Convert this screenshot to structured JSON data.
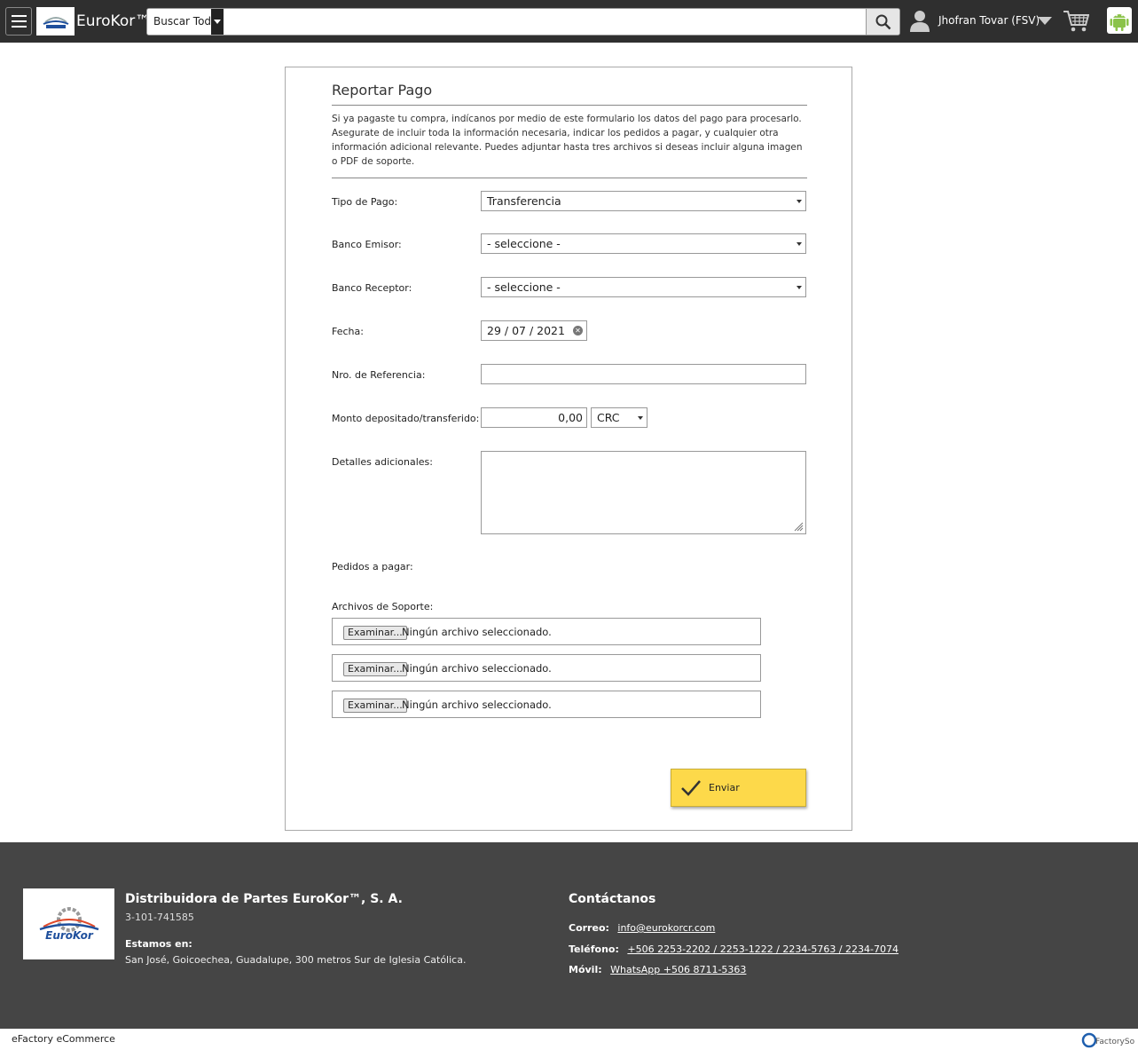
{
  "header": {
    "brand": "EuroKor™",
    "search_category": "Buscar Todo",
    "search_placeholder": "",
    "user_name": "Jhofran Tovar (FSV)"
  },
  "form": {
    "title": "Reportar Pago",
    "intro": "Si ya pagaste tu compra, indícanos por medio de este formulario los datos del pago para procesarlo. Asegurate de incluir toda la información necesaria, indicar los pedidos a pagar, y cualquier otra información adicional relevante. Puedes adjuntar hasta tres archivos si deseas incluir alguna imagen o PDF de soporte.",
    "fields": {
      "tipo_pago": {
        "label": "Tipo de Pago:",
        "value": "Transferencia"
      },
      "banco_emisor": {
        "label": "Banco Emisor:",
        "value": "- seleccione -"
      },
      "banco_receptor": {
        "label": "Banco Receptor:",
        "value": "- seleccione -"
      },
      "fecha": {
        "label": "Fecha:",
        "value": "29 / 07 / 2021"
      },
      "referencia": {
        "label": "Nro. de Referencia:",
        "value": ""
      },
      "monto": {
        "label": "Monto depositado/transferido:",
        "value": "0,00",
        "currency": "CRC"
      },
      "detalles": {
        "label": "Detalles adicionales:",
        "value": ""
      },
      "pedidos": {
        "label": "Pedidos a pagar:"
      },
      "archivos": {
        "label": "Archivos de Soporte:"
      }
    },
    "files": [
      {
        "button": "Examinar...",
        "status": "Ningún archivo seleccionado."
      },
      {
        "button": "Examinar...",
        "status": "Ningún archivo seleccionado."
      },
      {
        "button": "Examinar...",
        "status": "Ningún archivo seleccionado."
      }
    ],
    "submit_label": "Enviar"
  },
  "footer": {
    "company": "Distribuidora de Partes EuroKor™, S. A.",
    "company_id": "3-101-741585",
    "located_label": "Estamos en:",
    "address": "San José, Goicoechea, Guadalupe, 300 metros Sur de Iglesia Católica.",
    "contact_title": "Contáctanos",
    "email_label": "Correo:",
    "email": "info@eurokorcr.com",
    "phone_label": "Teléfono:",
    "phones": "+506 2253-2202 / 2253-1222 / 2234-5763 / 2234-7074",
    "mobile_label": "Móvil:",
    "mobile": "WhatsApp +506 8711-5363"
  },
  "bottom": {
    "text": "eFactory eCommerce",
    "logo_text": "FactorySoft"
  },
  "colors": {
    "topbar": "#2f2f2f",
    "footer": "#454545",
    "submit": "#fdd94a"
  }
}
